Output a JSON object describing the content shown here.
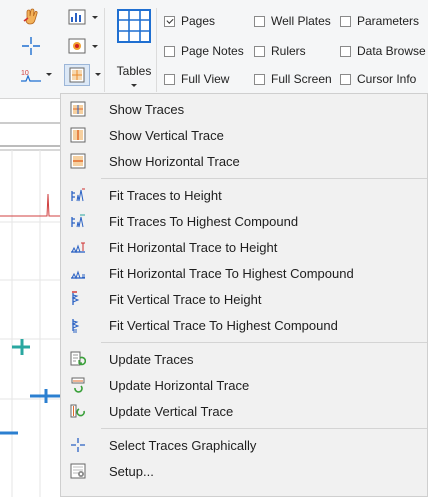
{
  "ribbon": {
    "tables_label": "Tables",
    "checks": [
      {
        "label": "Pages",
        "checked": true
      },
      {
        "label": "Well Plates",
        "checked": false
      },
      {
        "label": "Parameters",
        "checked": false
      },
      {
        "label": "Page Notes",
        "checked": false
      },
      {
        "label": "Rulers",
        "checked": false
      },
      {
        "label": "Data Browse",
        "checked": false
      },
      {
        "label": "Full View",
        "checked": false
      },
      {
        "label": "Full Screen",
        "checked": false
      },
      {
        "label": "Cursor Info",
        "checked": false
      }
    ]
  },
  "menu": {
    "items": [
      {
        "label": "Show Traces",
        "icon": "show-traces-icon"
      },
      {
        "label": "Show Vertical Trace",
        "icon": "show-vertical-trace-icon"
      },
      {
        "label": "Show Horizontal Trace",
        "icon": "show-horizontal-trace-icon"
      },
      {
        "label": "Fit Traces to Height",
        "icon": "fit-traces-height-icon"
      },
      {
        "label": "Fit Traces To Highest Compound",
        "icon": "fit-traces-highest-icon"
      },
      {
        "label": "Fit Horizontal Trace to Height",
        "icon": "fit-horizontal-height-icon"
      },
      {
        "label": "Fit Horizontal Trace To Highest Compound",
        "icon": "fit-horizontal-highest-icon"
      },
      {
        "label": "Fit Vertical Trace to Height",
        "icon": "fit-vertical-height-icon"
      },
      {
        "label": "Fit Vertical Trace To Highest Compound",
        "icon": "fit-vertical-highest-icon"
      },
      {
        "label": "Update Traces",
        "icon": "update-traces-icon"
      },
      {
        "label": "Update Horizontal Trace",
        "icon": "update-horizontal-icon"
      },
      {
        "label": "Update Vertical Trace",
        "icon": "update-vertical-icon"
      },
      {
        "label": "Select Traces Graphically",
        "icon": "crosshair-icon"
      },
      {
        "label": "Setup...",
        "icon": "setup-icon"
      }
    ]
  },
  "colors": {
    "accent_blue": "#1f6fd1",
    "teal": "#2aa7a0",
    "menu_bg": "#f1f1f1",
    "orange": "#e98a2a"
  }
}
